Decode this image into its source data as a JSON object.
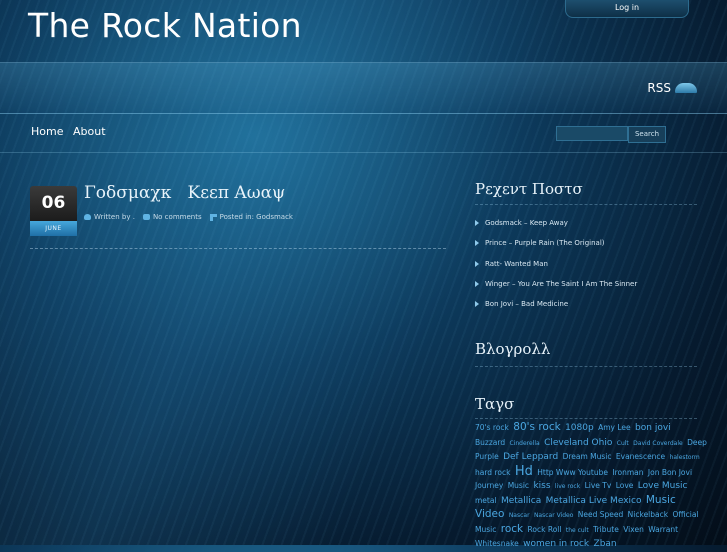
{
  "header": {
    "site_title": "The Rock Nation",
    "login_label": "Log in",
    "rss_label": "RSS"
  },
  "nav": {
    "items": [
      {
        "label": "Home"
      },
      {
        "label": "About"
      }
    ],
    "search_button": "Search",
    "search_value": ""
  },
  "post": {
    "day": "06",
    "month": "JUNE",
    "title": "Γοδσμαχκ   Κεεπ Αωαψ",
    "written_by": "Written by .",
    "comments": "No comments",
    "posted_in": "Posted in: Godsmack"
  },
  "sidebar": {
    "recent_title": "Ρεχεντ Ποστσ",
    "recent_posts": [
      "Godsmack – Keep Away",
      "Prince – Purple Rain (The Original)",
      "Ratt- Wanted Man",
      "Winger – You Are The Saint I Am The Sinner",
      "Bon Jovi – Bad Medicine"
    ],
    "blogroll_title": "Βλογρολλ",
    "tags_title": "Ταγσ",
    "tags": [
      {
        "label": "70's rock",
        "size": "s"
      },
      {
        "label": "80's rock",
        "size": "l"
      },
      {
        "label": "1080p",
        "size": "m"
      },
      {
        "label": "Amy Lee",
        "size": "s"
      },
      {
        "label": "bon jovi",
        "size": "m"
      },
      {
        "label": "Buzzard",
        "size": "s"
      },
      {
        "label": "Cinderella",
        "size": "xs"
      },
      {
        "label": "Cleveland Ohio",
        "size": "m"
      },
      {
        "label": "Cult",
        "size": "xs"
      },
      {
        "label": "David Coverdale",
        "size": "xs"
      },
      {
        "label": "Deep Purple",
        "size": "s"
      },
      {
        "label": "Def Leppard",
        "size": "m"
      },
      {
        "label": "Dream Music",
        "size": "s"
      },
      {
        "label": "Evanescence",
        "size": "s"
      },
      {
        "label": "halestorm",
        "size": "xs"
      },
      {
        "label": "hard rock",
        "size": "s"
      },
      {
        "label": "Hd",
        "size": "xl"
      },
      {
        "label": "Http Www Youtube",
        "size": "s"
      },
      {
        "label": "Ironman",
        "size": "s"
      },
      {
        "label": "Jon Bon Jovi",
        "size": "s"
      },
      {
        "label": "Journey",
        "size": "s"
      },
      {
        "label": "Music",
        "size": "s"
      },
      {
        "label": "kiss",
        "size": "m"
      },
      {
        "label": "live rock",
        "size": "xs"
      },
      {
        "label": "Live Tv",
        "size": "s"
      },
      {
        "label": "Love",
        "size": "s"
      },
      {
        "label": "Love Music",
        "size": "m"
      },
      {
        "label": "metal",
        "size": "s"
      },
      {
        "label": "Metallica",
        "size": "m"
      },
      {
        "label": "Metallica Live Mexico",
        "size": "m"
      },
      {
        "label": "Music Video",
        "size": "l"
      },
      {
        "label": "Nascar",
        "size": "xs"
      },
      {
        "label": "Nascar Video",
        "size": "xs"
      },
      {
        "label": "Need Speed",
        "size": "s"
      },
      {
        "label": "Nickelback",
        "size": "s"
      },
      {
        "label": "Official Music",
        "size": "s"
      },
      {
        "label": "rock",
        "size": "l"
      },
      {
        "label": "Rock Roll",
        "size": "s"
      },
      {
        "label": "the cult",
        "size": "xs"
      },
      {
        "label": "Tribute",
        "size": "s"
      },
      {
        "label": "Vixen",
        "size": "s"
      },
      {
        "label": "Warrant",
        "size": "s"
      },
      {
        "label": "Whitesnake",
        "size": "s"
      },
      {
        "label": "women in rock",
        "size": "m"
      },
      {
        "label": "Zban",
        "size": "m"
      }
    ]
  }
}
